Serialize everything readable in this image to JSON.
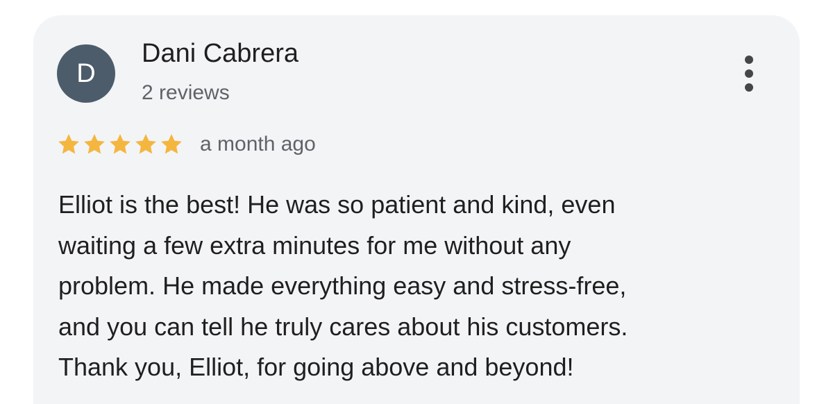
{
  "review": {
    "author": {
      "initial": "D",
      "name": "Dani Cabrera",
      "review_count": "2 reviews"
    },
    "rating": 5,
    "rating_max": 5,
    "date": "a month ago",
    "text_lines": [
      "Elliot is the best! He was so patient and kind, even",
      "waiting a few extra minutes for me without any",
      "problem. He made everything easy and stress-free,",
      "and you can tell he truly cares about his customers.",
      "Thank you, Elliot, for going above and beyond!"
    ]
  },
  "icons": {
    "more": "more-vertical-icon",
    "star": "star-icon"
  },
  "colors": {
    "card_background": "#f3f4f6",
    "avatar_background": "#4c5c6a",
    "star": "#f4b63f",
    "primary_text": "#1f1f1f",
    "secondary_text": "#5f6368"
  }
}
